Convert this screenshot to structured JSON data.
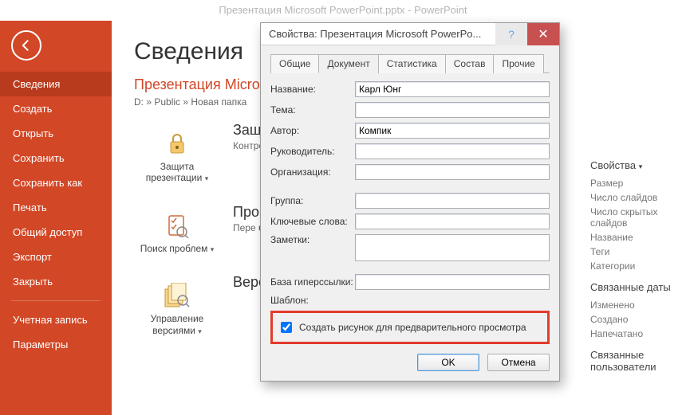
{
  "app": {
    "titlebar": "Презентация Microsoft PowerPoint.pptx - PowerPoint"
  },
  "sidebar": {
    "items": [
      "Сведения",
      "Создать",
      "Открыть",
      "Сохранить",
      "Сохранить как",
      "Печать",
      "Общий доступ",
      "Экспорт",
      "Закрыть"
    ],
    "footer": [
      "Учетная запись",
      "Параметры"
    ],
    "active_index": 0
  },
  "page": {
    "heading": "Сведения",
    "doc_name": "Презентация Microsoft PowerPoint",
    "path": "D: » Public » Новая папка",
    "cards": [
      {
        "label": "Защита презентации",
        "desc_head": "Защита презентации",
        "desc_body": "Контроль\nвнос"
      },
      {
        "label": "Поиск проблем",
        "desc_head": "Проверка презентации",
        "desc_body": "Пере\n■"
      },
      {
        "label": "Управление версиями",
        "desc_head": "Версии",
        "desc_body": ""
      }
    ]
  },
  "right": {
    "sect_props": "Свойства",
    "props": [
      "Размер",
      "Число слайдов",
      "Число скрытых слайдов",
      "Название",
      "Теги",
      "Категории"
    ],
    "sect_dates": "Связанные даты",
    "dates": [
      "Изменено",
      "Создано",
      "Напечатано"
    ],
    "sect_users": "Связанные пользователи"
  },
  "dialog": {
    "title": "Свойства: Презентация Microsoft PowerPo...",
    "tabs": [
      "Общие",
      "Документ",
      "Статистика",
      "Состав",
      "Прочие"
    ],
    "active_tab": 1,
    "fields": {
      "title_label": "Название:",
      "title_value": "Карл Юнг",
      "subject_label": "Тема:",
      "subject_value": "",
      "author_label": "Автор:",
      "author_value": "Компик",
      "manager_label": "Руководитель:",
      "manager_value": "",
      "company_label": "Организация:",
      "company_value": "",
      "category_label": "Группа:",
      "category_value": "",
      "keywords_label": "Ключевые слова:",
      "keywords_value": "",
      "comments_label": "Заметки:",
      "comments_value": "",
      "hyperlink_label": "База гиперссылки:",
      "hyperlink_value": "",
      "template_label": "Шаблон:",
      "template_value": ""
    },
    "checkbox_label": "Создать рисунок для предварительного просмотра",
    "checkbox_checked": true,
    "ok": "OK",
    "cancel": "Отмена"
  }
}
